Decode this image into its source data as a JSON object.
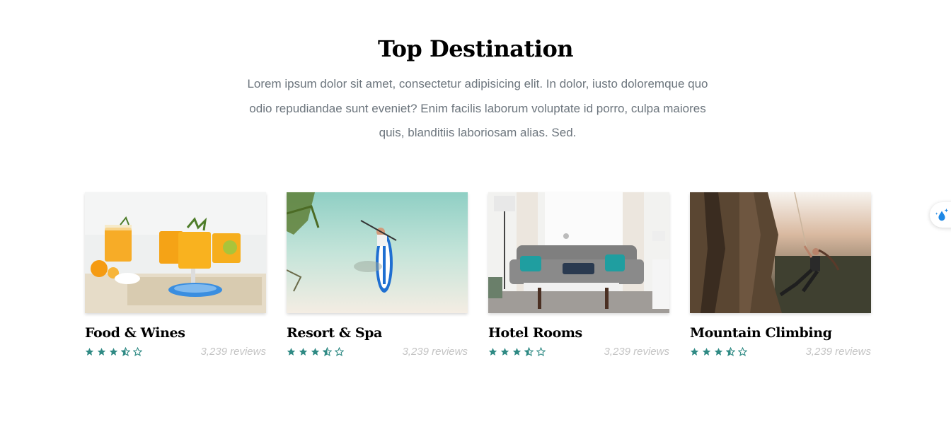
{
  "section": {
    "title": "Top Destination",
    "description": "Lorem ipsum dolor sit amet, consectetur adipisicing elit. In dolor, iusto doloremque quo odio repudiandae sunt eveniet? Enim facilis laborum voluptate id porro, culpa maiores quis, blanditiis laboriosam alias. Sed."
  },
  "cards": [
    {
      "title": "Food & Wines",
      "rating": 3.5,
      "max_rating": 5,
      "reviews": "3,239 reviews",
      "image": "orange-drinks-photo"
    },
    {
      "title": "Resort & Spa",
      "rating": 3.5,
      "max_rating": 5,
      "reviews": "3,239 reviews",
      "image": "paddleboard-beach-photo"
    },
    {
      "title": "Hotel Rooms",
      "rating": 3.5,
      "max_rating": 5,
      "reviews": "3,239 reviews",
      "image": "living-room-photo"
    },
    {
      "title": "Mountain Climbing",
      "rating": 3.5,
      "max_rating": 5,
      "reviews": "3,239 reviews",
      "image": "rock-climber-photo"
    }
  ],
  "colors": {
    "star": "#2f8a84",
    "reviews": "#c4c4c4",
    "description": "#6c757d",
    "widget_accent": "#1e88e5"
  },
  "widget": {
    "icon": "water-drop-sparkle-icon"
  }
}
